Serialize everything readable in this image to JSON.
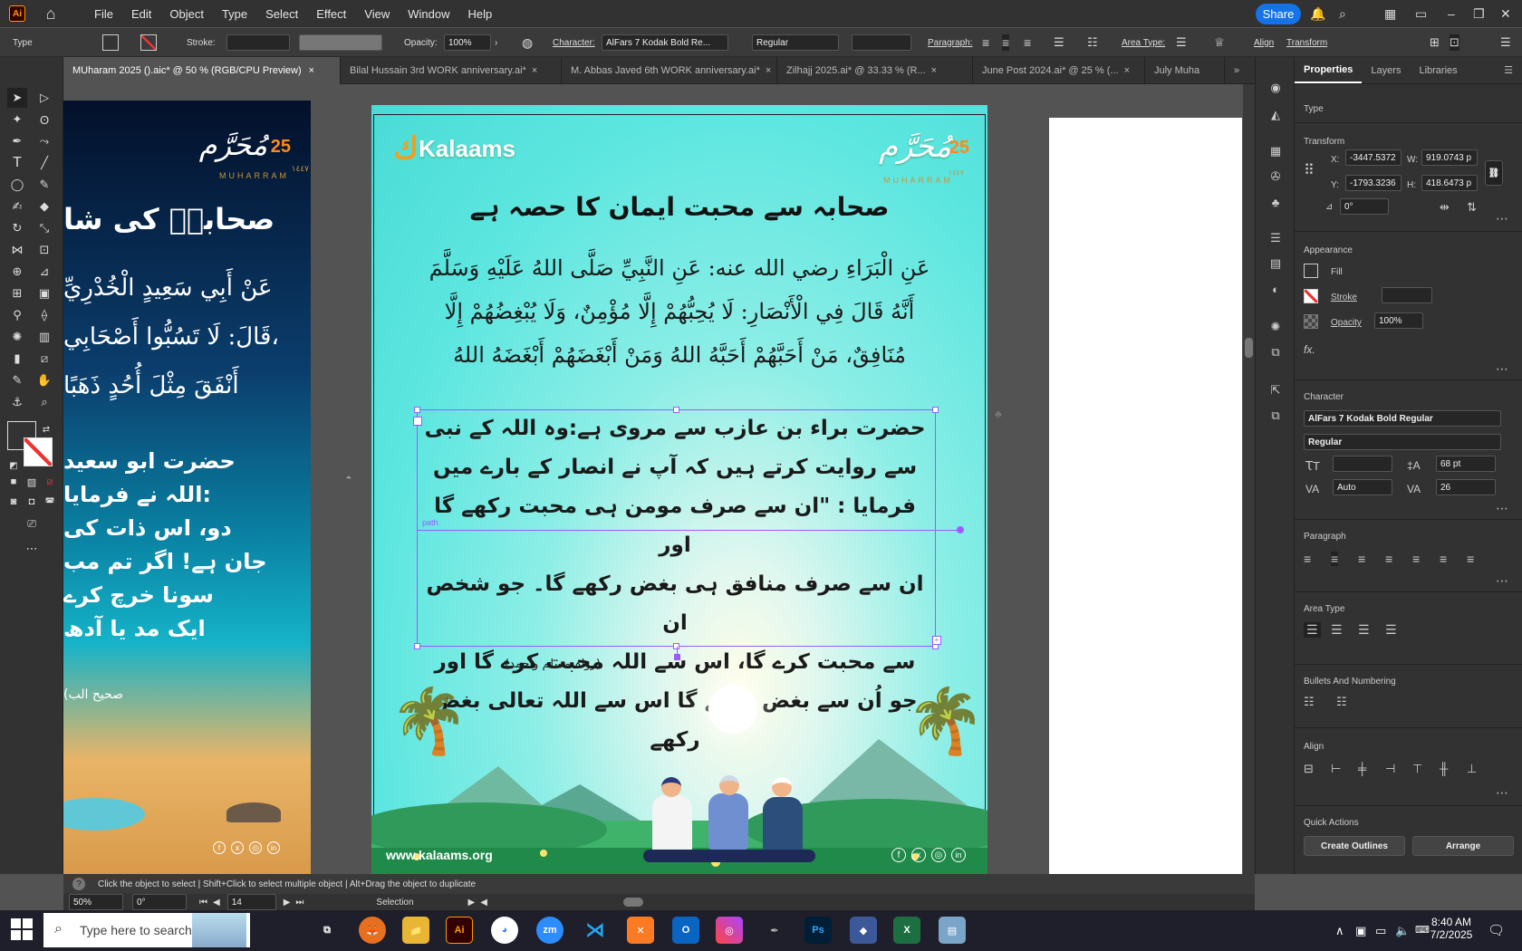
{
  "menubar": {
    "app_icon": "Ai",
    "items": [
      "File",
      "Edit",
      "Object",
      "Type",
      "Select",
      "Effect",
      "View",
      "Window",
      "Help"
    ],
    "share": "Share"
  },
  "control": {
    "mode": "Type",
    "stroke_label": "Stroke:",
    "opacity_label": "Opacity:",
    "opacity": "100%",
    "character_label": "Character:",
    "font": "AlFars 7 Kodak Bold Re...",
    "style": "Regular",
    "paragraph_label": "Paragraph:",
    "area_type_label": "Area Type:",
    "align": "Align",
    "transform": "Transform"
  },
  "tabs": [
    "MUharam 2025 ().aic* @ 50 % (RGB/CPU Preview)",
    "Bilal Hussain  3rd  WORK anniversary.ai*",
    "M. Abbas Javed  6th  WORK anniversary.ai*",
    "Zilhajj 2025.ai* @ 33.33 % (R...",
    "June Post 2024.ai* @ 25 % (...",
    "July Muha"
  ],
  "artleft": {
    "badge": "25",
    "muharram_ar": "مُحَرَّم",
    "muharram_en": "MUHARRAM",
    "year": "١٤٤٧",
    "title": "صحابہؓ کی شا",
    "arabic": [
      "عَنْ أَبِي سَعِيدٍ الْخُدْرِيِّ",
      "قَالَ: لَا تَسُبُّوا أَصْحَابِي،",
      "أَنْفَقَ مِثْلَ أُحُدٍ ذَهَبًا"
    ],
    "urdu": [
      "حضرت ابو سعید",
      "اللہ  نے فرمایا:",
      "دو، اس ذات کی",
      "جان ہے! اگر تم مب",
      "سونا خرچ کرے",
      "ایک مد یا آدھ"
    ],
    "source": "(صحیح الب"
  },
  "art": {
    "logo": "Kalaams",
    "badge": "25",
    "muharram_ar": "مُحَرَّم",
    "muharram_en": "MUHARRAM",
    "year": "١٤٤٧",
    "title": "صحابہ سے محبت ایمان کا حصہ ہے",
    "arabic": [
      "عَنِ الْبَرَاءِ رضي الله عنه: عَنِ النَّبِيِّ صَلَّى اللهُ عَلَيْهِ وَسَلَّمَ",
      "أَنَّهُ قَالَ فِي الْأَنْصَارِ: لَا يُحِبُّهُمْ إِلَّا مُؤْمِنٌ، وَلَا يُبْغِضُهُمْ إِلَّا",
      "مُنَافِقٌ، مَنْ أَحَبَّهُمْ أَحَبَّهُ اللهُ وَمَنْ أَبْغَضَهُمْ أَبْغَضَهُ اللهُ"
    ],
    "urdu": [
      "حضرت براء بن عازب سے مروی ہے:وہ اللہ کے نبی",
      "سے روایت کرتے ہیں کہ آپ نے انصار کے بارے میں",
      "فرمایا : \"ان سے صرف مومن ہی محبت رکھے گا اور",
      "ان سے صرف منافق ہی بغض رکھے گا۔ جو شخص ان",
      "سے محبت کرے گا، اس سے اللہ محبت کرے گا اور",
      "جو اُن سے بغض رکھے گا اس سے اللہ تعالی بغض رکھے"
    ],
    "path_label": "path",
    "source": "(رواہ مسلم وأحمد)",
    "website": "www.kalaams.org"
  },
  "panel": {
    "tabs": [
      "Properties",
      "Layers",
      "Libraries"
    ],
    "type": "Type",
    "transform": "Transform",
    "x_label": "X:",
    "x": "-3447.5372",
    "y_label": "Y:",
    "y": "-1793.3236",
    "w_label": "W:",
    "w": "919.0743 p",
    "h_label": "H:",
    "h": "418.6473 p",
    "angle": "0°",
    "appearance": "Appearance",
    "fill": "Fill",
    "stroke": "Stroke",
    "opacity": "Opacity",
    "opacity_val": "100%",
    "fx": "fx.",
    "character": "Character",
    "font": "AlFars 7 Kodak Bold Regular",
    "font_style": "Regular",
    "font_size": "68 pt",
    "tracking": "Auto",
    "leading": "26",
    "paragraph": "Paragraph",
    "area_type": "Area Type",
    "bullets": "Bullets And Numbering",
    "align": "Align",
    "quick": "Quick Actions",
    "create_outlines": "Create Outlines",
    "arrange": "Arrange"
  },
  "status": {
    "hint": "Click the object to select  |  Shift+Click to select multiple object  |  Alt+Drag the object to duplicate",
    "zoom": "50%",
    "angle": "0°",
    "page": "14",
    "mode": "Selection"
  },
  "taskbar": {
    "search": "Type here to search",
    "time": "8:40 AM",
    "date": "7/2/2025"
  }
}
